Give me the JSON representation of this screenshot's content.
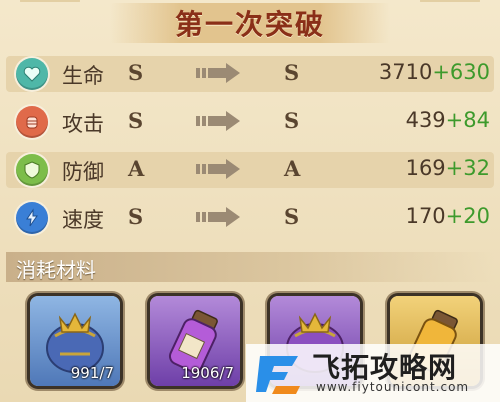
{
  "title": "第一次突破",
  "stats": [
    {
      "label": "生命",
      "from": "S",
      "to": "S",
      "base": "3710",
      "bonus": "+630",
      "icon": "heart-icon",
      "color": "#4fb7a8"
    },
    {
      "label": "攻击",
      "from": "S",
      "to": "S",
      "base": "439",
      "bonus": "+84",
      "icon": "fist-icon",
      "color": "#e06a4a"
    },
    {
      "label": "防御",
      "from": "A",
      "to": "A",
      "base": "169",
      "bonus": "+32",
      "icon": "shield-icon",
      "color": "#7dbd4a"
    },
    {
      "label": "速度",
      "from": "S",
      "to": "S",
      "base": "170",
      "bonus": "+20",
      "icon": "lightning-icon",
      "color": "#3a7fd6"
    }
  ],
  "materials_label": "消耗材料",
  "materials": [
    {
      "count": "991/7",
      "icon": "blue-crown-icon",
      "rarity": "blue"
    },
    {
      "count": "1906/7",
      "icon": "purple-potion-icon",
      "rarity": "purple"
    },
    {
      "count": "",
      "icon": "purple-crown-icon",
      "rarity": "purple"
    },
    {
      "count": "",
      "icon": "gold-potion-icon",
      "rarity": "gold"
    }
  ],
  "watermark": {
    "name": "飞拓攻略网",
    "url": "www.fiytounicont.com"
  }
}
